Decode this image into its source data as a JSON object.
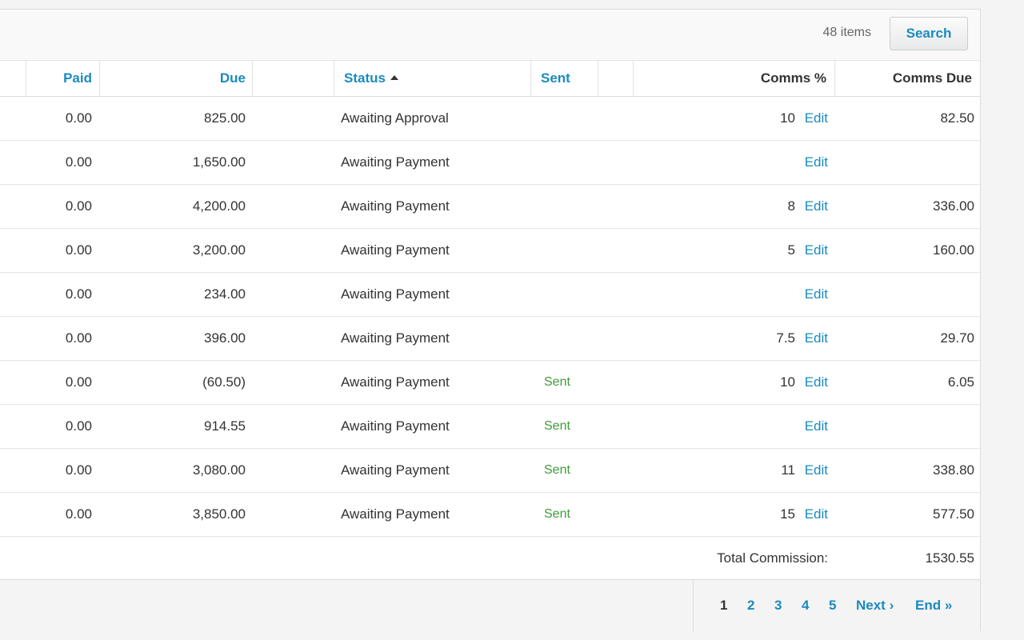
{
  "toolbar": {
    "items_count": "48 items",
    "search_label": "Search"
  },
  "columns": {
    "paid": "Paid",
    "due": "Due",
    "status": "Status",
    "sent": "Sent",
    "comms_pct": "Comms %",
    "comms_due": "Comms Due"
  },
  "rows": [
    {
      "paid": "0.00",
      "due": "825.00",
      "status": "Awaiting Approval",
      "sent": "",
      "comms_pct": "10",
      "edit": "Edit",
      "comms_due": "82.50"
    },
    {
      "paid": "0.00",
      "due": "1,650.00",
      "status": "Awaiting Payment",
      "sent": "",
      "comms_pct": "",
      "edit": "Edit",
      "comms_due": ""
    },
    {
      "paid": "0.00",
      "due": "4,200.00",
      "status": "Awaiting Payment",
      "sent": "",
      "comms_pct": "8",
      "edit": "Edit",
      "comms_due": "336.00"
    },
    {
      "paid": "0.00",
      "due": "3,200.00",
      "status": "Awaiting Payment",
      "sent": "",
      "comms_pct": "5",
      "edit": "Edit",
      "comms_due": "160.00"
    },
    {
      "paid": "0.00",
      "due": "234.00",
      "status": "Awaiting Payment",
      "sent": "",
      "comms_pct": "",
      "edit": "Edit",
      "comms_due": ""
    },
    {
      "paid": "0.00",
      "due": "396.00",
      "status": "Awaiting Payment",
      "sent": "",
      "comms_pct": "7.5",
      "edit": "Edit",
      "comms_due": "29.70"
    },
    {
      "paid": "0.00",
      "due": "(60.50)",
      "status": "Awaiting Payment",
      "sent": "Sent",
      "comms_pct": "10",
      "edit": "Edit",
      "comms_due": "6.05"
    },
    {
      "paid": "0.00",
      "due": "914.55",
      "status": "Awaiting Payment",
      "sent": "Sent",
      "comms_pct": "",
      "edit": "Edit",
      "comms_due": ""
    },
    {
      "paid": "0.00",
      "due": "3,080.00",
      "status": "Awaiting Payment",
      "sent": "Sent",
      "comms_pct": "11",
      "edit": "Edit",
      "comms_due": "338.80"
    },
    {
      "paid": "0.00",
      "due": "3,850.00",
      "status": "Awaiting Payment",
      "sent": "Sent",
      "comms_pct": "15",
      "edit": "Edit",
      "comms_due": "577.50"
    }
  ],
  "totals": {
    "label": "Total Commission:",
    "value": "1530.55"
  },
  "pagination": {
    "pages": [
      "1",
      "2",
      "3",
      "4",
      "5"
    ],
    "current": "1",
    "next": "Next ›",
    "end": "End »"
  },
  "colors": {
    "link": "#1a8bbf",
    "sent": "#3f9b3a",
    "text": "#333333"
  }
}
